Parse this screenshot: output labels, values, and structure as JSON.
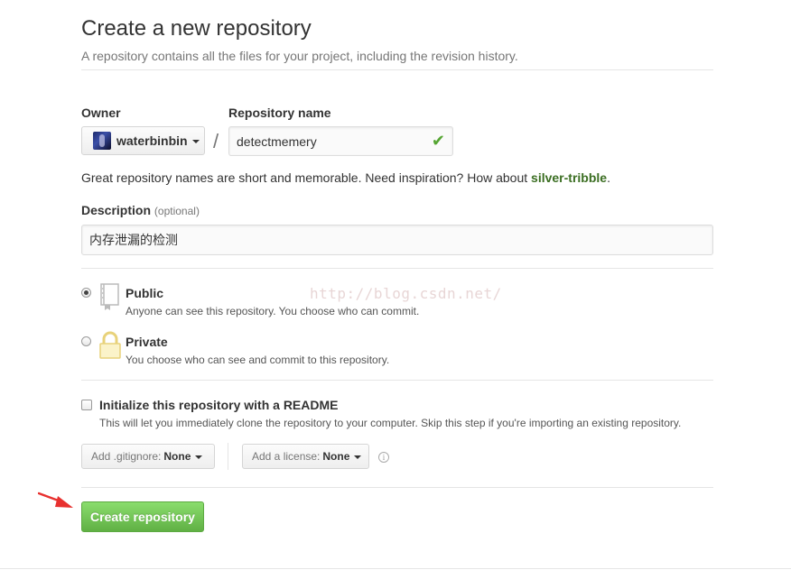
{
  "header": {
    "title": "Create a new repository",
    "subtitle": "A repository contains all the files for your project, including the revision history."
  },
  "owner": {
    "label": "Owner",
    "value": "waterbinbin"
  },
  "separator": "/",
  "repository": {
    "label": "Repository name",
    "value": "detectmemery",
    "valid_icon": "checkmark-icon"
  },
  "hint": {
    "prefix": "Great repository names are short and memorable. Need inspiration? How about ",
    "suggestion": "silver-tribble",
    "suffix": "."
  },
  "description": {
    "label": "Description",
    "optional": "(optional)",
    "value": "内存泄漏的检测"
  },
  "visibility": {
    "selected": "public",
    "options": [
      {
        "id": "public",
        "title": "Public",
        "desc": "Anyone can see this repository. You choose who can commit.",
        "icon": "repo-book-icon"
      },
      {
        "id": "private",
        "title": "Private",
        "desc": "You choose who can see and commit to this repository.",
        "icon": "lock-icon"
      }
    ]
  },
  "watermark": "http://blog.csdn.net/",
  "readme": {
    "checked": false,
    "title": "Initialize this repository with a README",
    "desc": "This will let you immediately clone the repository to your computer. Skip this step if you're importing an existing repository."
  },
  "gitignore": {
    "prefix": "Add .gitignore:",
    "value": "None"
  },
  "license": {
    "prefix": "Add a license:",
    "value": "None"
  },
  "create_button": "Create repository",
  "colors": {
    "accent_green": "#60b044",
    "suggestion_green": "#3b6e22",
    "annotation_arrow": "#e8312f",
    "lock_yellow": "#e8d27a"
  }
}
